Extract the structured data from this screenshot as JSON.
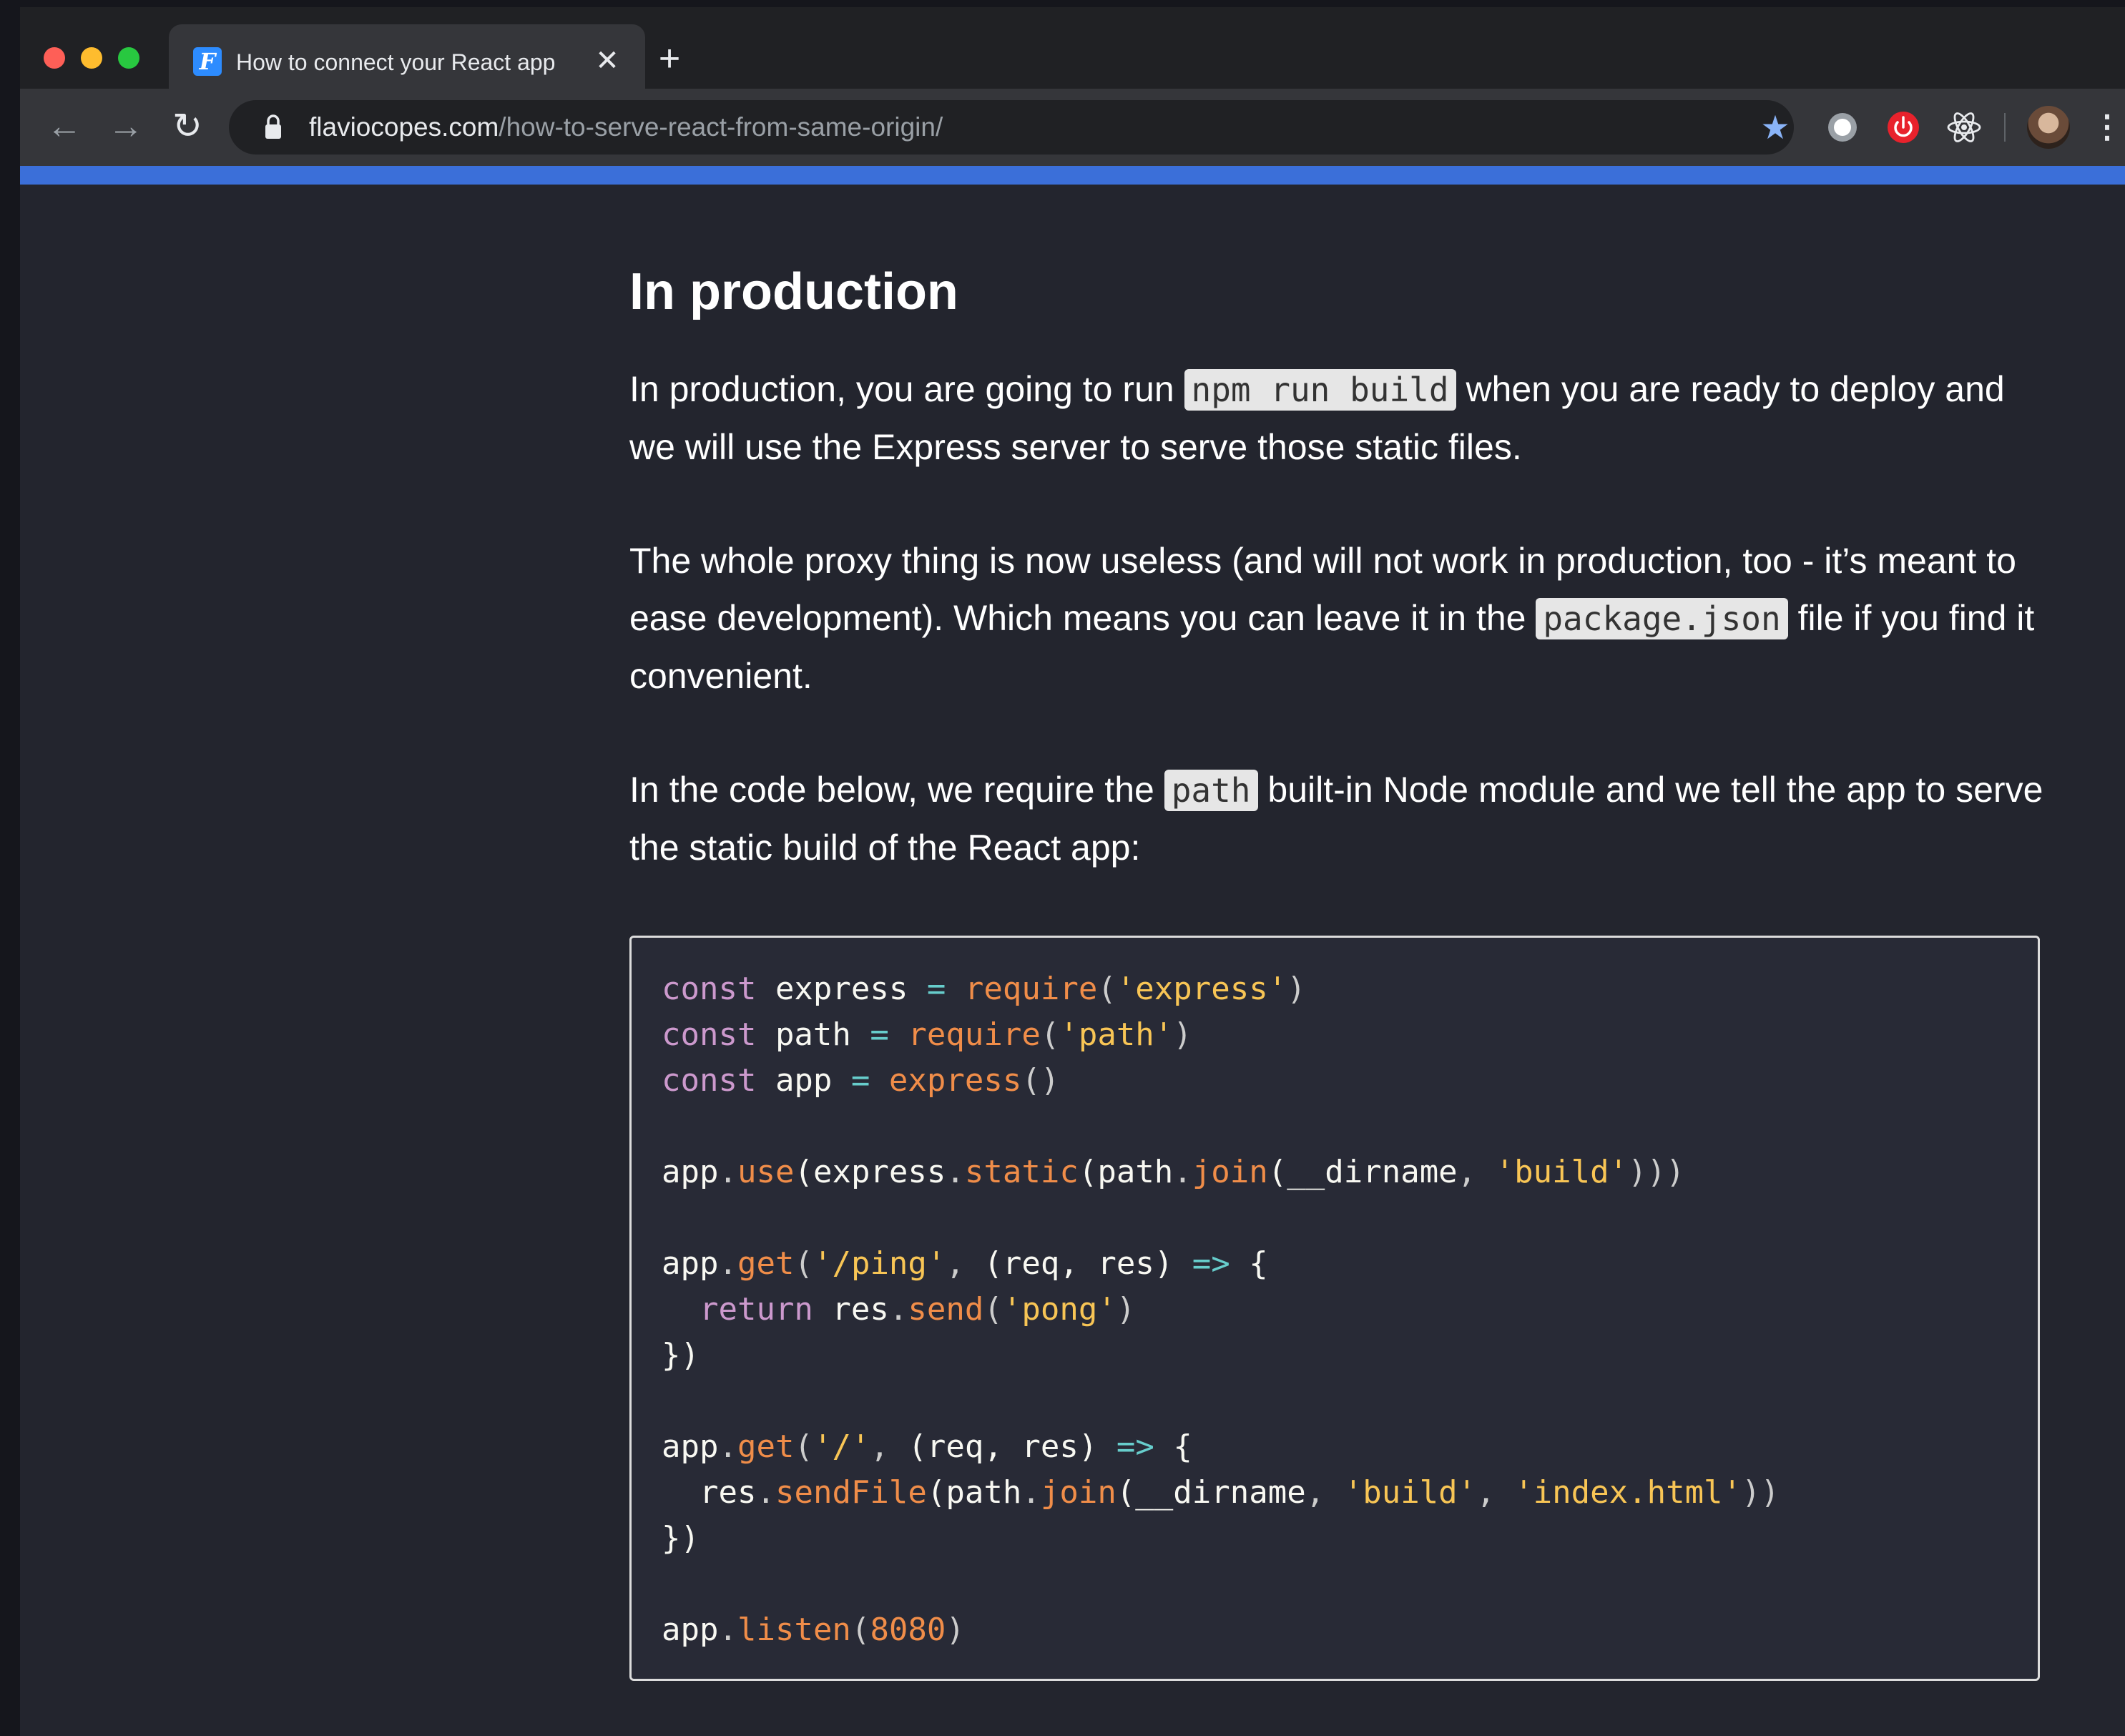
{
  "browser": {
    "tab": {
      "favicon_letter": "F",
      "title": "How to connect your React app",
      "close_glyph": "✕"
    },
    "new_tab_glyph": "+",
    "toolbar": {
      "back_glyph": "←",
      "forward_glyph": "→",
      "reload_glyph": "↻",
      "url_host": "flaviocopes.com",
      "url_path": "/how-to-serve-react-from-same-origin/",
      "star_glyph": "★",
      "menu_glyph": "⋮"
    },
    "icons": [
      "lock-icon",
      "star-icon",
      "record-extension-icon",
      "power-extension-icon",
      "react-devtools-icon",
      "profile-avatar",
      "menu-icon"
    ],
    "colors": {
      "progress": "#3b6fd9",
      "star": "#8ab4f8",
      "power_extension": "#e8222c"
    }
  },
  "article": {
    "heading": "In production",
    "p1": {
      "before": "In production, you are going to run ",
      "code": "npm run build",
      "after": " when you are ready to deploy and we will use the Express server to serve those static files."
    },
    "p2": {
      "before": "The whole proxy thing is now useless (and will not work in production, too - it’s meant to ease development). Which means you can leave it in the ",
      "code": "package.json",
      "after": " file if you find it convenient."
    },
    "p3": {
      "before": "In the code below, we require the ",
      "code": "path",
      "after": " built-in Node module and we tell the app to serve the static build of the React app:"
    },
    "code": {
      "line1": {
        "kw": "const",
        "name": " express ",
        "op": "=",
        "fn": "require",
        "open": "(",
        "str": "'express'",
        "close": ")"
      },
      "line2": {
        "kw": "const",
        "name": " path ",
        "op": "=",
        "fn": "require",
        "open": "(",
        "str": "'path'",
        "close": ")"
      },
      "line3": {
        "kw": "const",
        "name": " app ",
        "op": "=",
        "fn": "express",
        "paren": "()"
      },
      "line4": {
        "obj": "app",
        "dot1": ".",
        "fn1": "use",
        "p1": "(express",
        "dot2": ".",
        "fn2": "static",
        "p2": "(path",
        "dot3": ".",
        "fn3": "join",
        "p3": "(__dirname",
        "comma": ",",
        "str": "'build'",
        "close": ")))"
      },
      "line5": {
        "obj": "app",
        "dot": ".",
        "fn": "get",
        "open": "(",
        "str": "'/ping'",
        "comma": ",",
        "args": " (req, res) ",
        "arrow": "=>",
        "brace": " {"
      },
      "line6": {
        "kw": "return",
        "obj": " res",
        "dot": ".",
        "fn": "send",
        "open": "(",
        "str": "'pong'",
        "close": ")"
      },
      "line7": "})",
      "line8": {
        "obj": "app",
        "dot": ".",
        "fn": "get",
        "open": "(",
        "str": "'/'",
        "comma": ",",
        "args": " (req, res) ",
        "arrow": "=>",
        "brace": " {"
      },
      "line9": {
        "obj": "res",
        "dot1": ".",
        "fn1": "sendFile",
        "p1": "(path",
        "dot2": ".",
        "fn2": "join",
        "p2": "(__dirname",
        "comma1": ",",
        "str1": "'build'",
        "comma2": ",",
        "str2": "'index.html'",
        "close": "))"
      },
      "line10": "})",
      "line11": {
        "obj": "app",
        "dot": ".",
        "fn": "listen",
        "open": "(",
        "num": "8080",
        "close": ")"
      }
    }
  }
}
